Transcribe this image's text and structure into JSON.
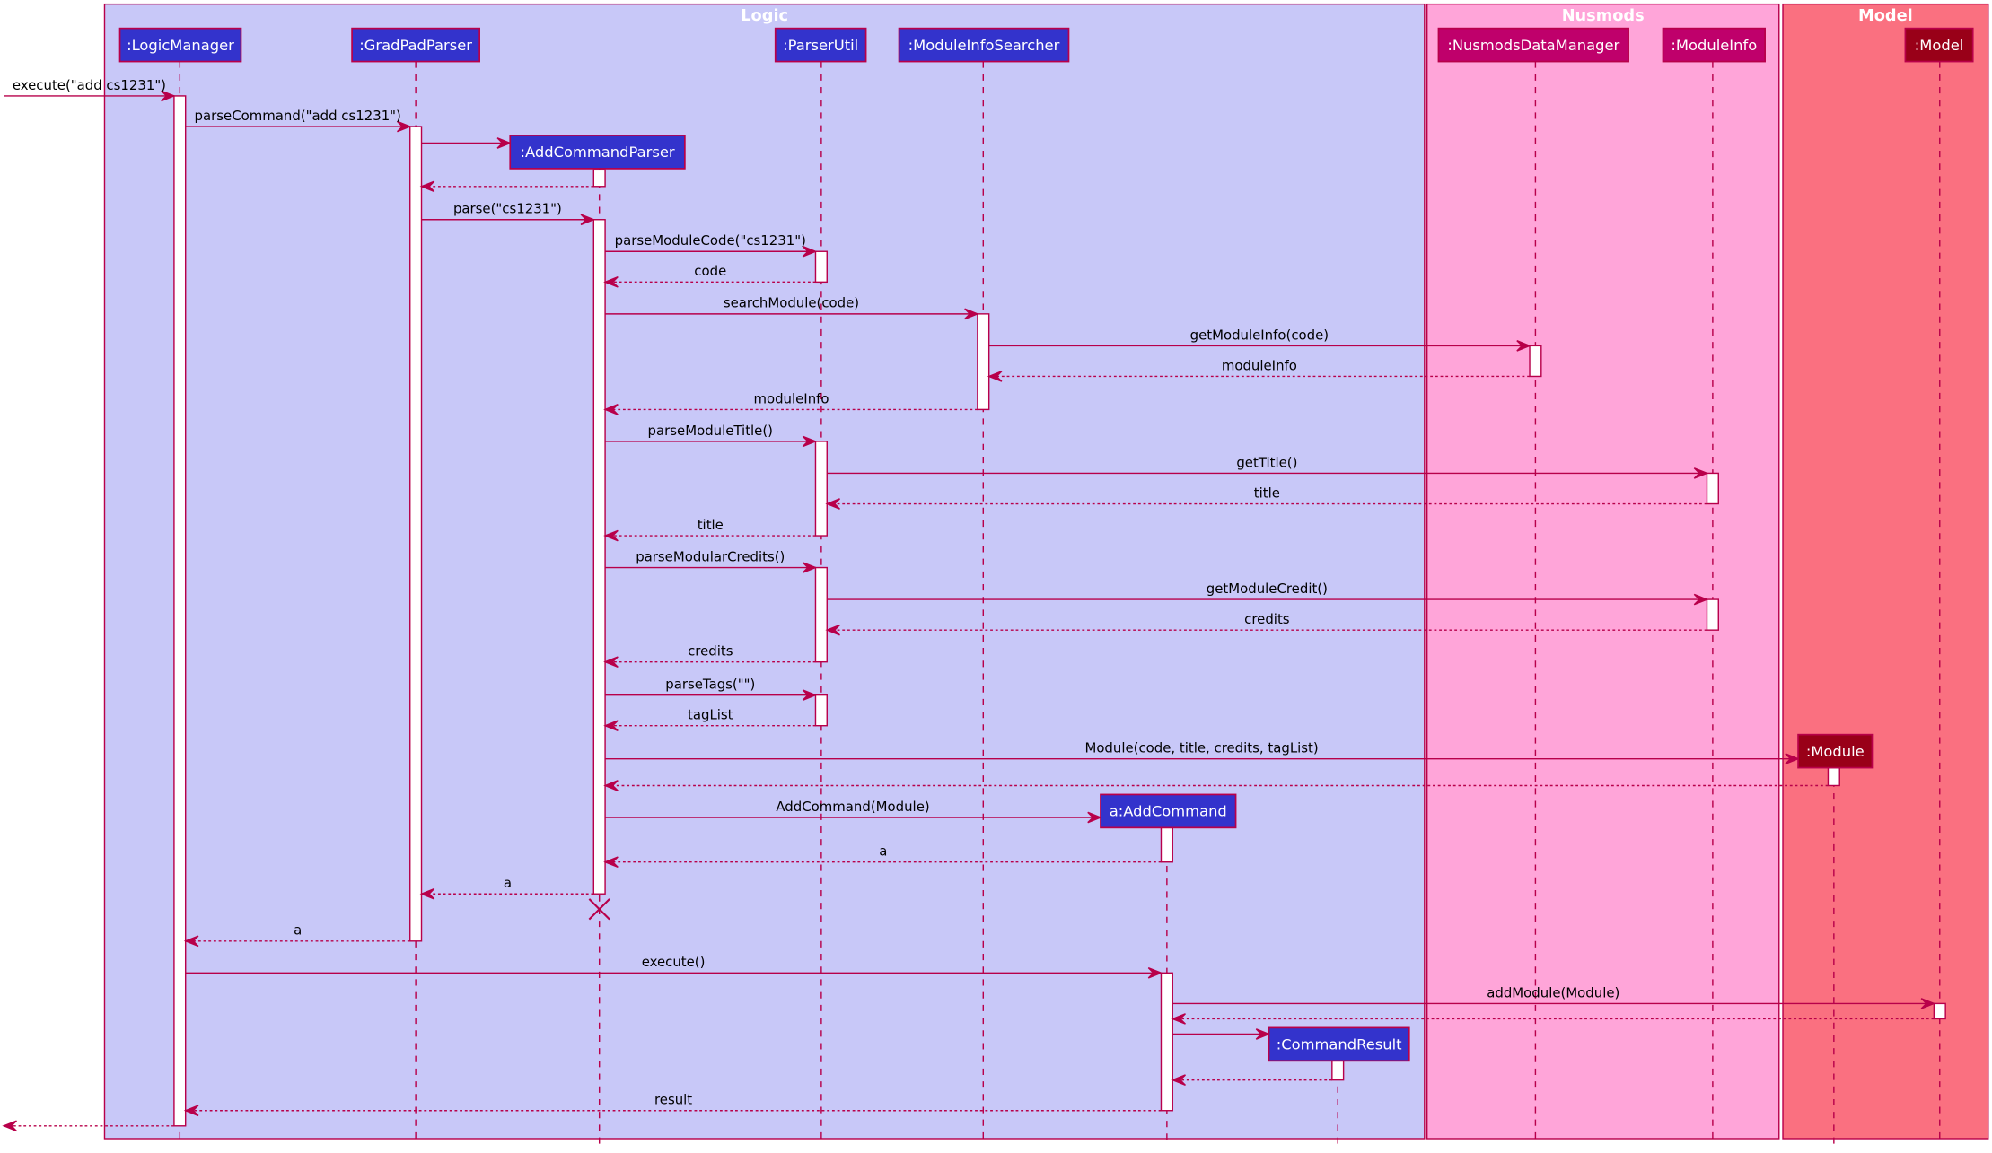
{
  "colors": {
    "line": "#b8004a",
    "logic_frame": "#c8c8f8",
    "nusmods_frame": "#ffa5d9",
    "model_frame": "#fa7080",
    "logic_participant": "#3333cc",
    "nusmods_participant": "#bf006b",
    "model_participant": "#990018"
  },
  "frames": [
    {
      "id": "logic",
      "title": "Logic"
    },
    {
      "id": "nusmods",
      "title": "Nusmods"
    },
    {
      "id": "model",
      "title": "Model"
    }
  ],
  "participants": [
    {
      "id": "lm",
      "label": ":LogicManager",
      "frame": "logic"
    },
    {
      "id": "gpp",
      "label": ":GradPadParser",
      "frame": "logic"
    },
    {
      "id": "acp",
      "label": ":AddCommandParser",
      "frame": "logic"
    },
    {
      "id": "pu",
      "label": ":ParserUtil",
      "frame": "logic"
    },
    {
      "id": "mis",
      "label": ":ModuleInfoSearcher",
      "frame": "logic"
    },
    {
      "id": "ac",
      "label": "a:AddCommand",
      "frame": "logic"
    },
    {
      "id": "cr",
      "label": ":CommandResult",
      "frame": "logic"
    },
    {
      "id": "ndm",
      "label": ":NusmodsDataManager",
      "frame": "nusmods"
    },
    {
      "id": "mi",
      "label": ":ModuleInfo",
      "frame": "nusmods"
    },
    {
      "id": "mod",
      "label": ":Module",
      "frame": "model"
    },
    {
      "id": "m",
      "label": ":Model",
      "frame": "model"
    }
  ],
  "messages": [
    {
      "from": "ext",
      "to": "lm",
      "label": "execute(\"add cs1231\")",
      "return": false
    },
    {
      "from": "lm",
      "to": "gpp",
      "label": "parseCommand(\"add cs1231\")",
      "return": false
    },
    {
      "from": "gpp",
      "to": "acp",
      "label": "",
      "return": false
    },
    {
      "from": "acp",
      "to": "gpp",
      "label": "",
      "return": true
    },
    {
      "from": "gpp",
      "to": "acp",
      "label": "parse(\"cs1231\")",
      "return": false
    },
    {
      "from": "acp",
      "to": "pu",
      "label": "parseModuleCode(\"cs1231\")",
      "return": false
    },
    {
      "from": "pu",
      "to": "acp",
      "label": "code",
      "return": true
    },
    {
      "from": "acp",
      "to": "mis",
      "label": "searchModule(code)",
      "return": false
    },
    {
      "from": "mis",
      "to": "ndm",
      "label": "getModuleInfo(code)",
      "return": false
    },
    {
      "from": "ndm",
      "to": "mis",
      "label": "moduleInfo",
      "return": true
    },
    {
      "from": "mis",
      "to": "acp",
      "label": "moduleInfo",
      "return": true
    },
    {
      "from": "acp",
      "to": "pu",
      "label": "parseModuleTitle()",
      "return": false
    },
    {
      "from": "pu",
      "to": "mi",
      "label": "getTitle()",
      "return": false
    },
    {
      "from": "mi",
      "to": "pu",
      "label": "title",
      "return": true
    },
    {
      "from": "pu",
      "to": "acp",
      "label": "title",
      "return": true
    },
    {
      "from": "acp",
      "to": "pu",
      "label": "parseModularCredits()",
      "return": false
    },
    {
      "from": "pu",
      "to": "mi",
      "label": "getModuleCredit()",
      "return": false
    },
    {
      "from": "mi",
      "to": "pu",
      "label": "credits",
      "return": true
    },
    {
      "from": "pu",
      "to": "acp",
      "label": "credits",
      "return": true
    },
    {
      "from": "acp",
      "to": "pu",
      "label": "parseTags(\"\")",
      "return": false
    },
    {
      "from": "pu",
      "to": "acp",
      "label": "tagList",
      "return": true
    },
    {
      "from": "acp",
      "to": "mod",
      "label": "Module(code, title, credits, tagList)",
      "return": false
    },
    {
      "from": "mod",
      "to": "acp",
      "label": "",
      "return": true
    },
    {
      "from": "acp",
      "to": "ac",
      "label": "AddCommand(Module)",
      "return": false
    },
    {
      "from": "ac",
      "to": "acp",
      "label": "a",
      "return": true
    },
    {
      "from": "acp",
      "to": "gpp",
      "label": "a",
      "return": true
    },
    {
      "from": "gpp",
      "to": "lm",
      "label": "a",
      "return": true
    },
    {
      "from": "lm",
      "to": "ac",
      "label": "execute()",
      "return": false
    },
    {
      "from": "ac",
      "to": "m",
      "label": "addModule(Module)",
      "return": false
    },
    {
      "from": "m",
      "to": "ac",
      "label": "",
      "return": true
    },
    {
      "from": "ac",
      "to": "cr",
      "label": "",
      "return": false
    },
    {
      "from": "cr",
      "to": "ac",
      "label": "",
      "return": true
    },
    {
      "from": "ac",
      "to": "lm",
      "label": "result",
      "return": true
    },
    {
      "from": "lm",
      "to": "ext",
      "label": "",
      "return": true
    }
  ],
  "destroyed": [
    "acp"
  ]
}
